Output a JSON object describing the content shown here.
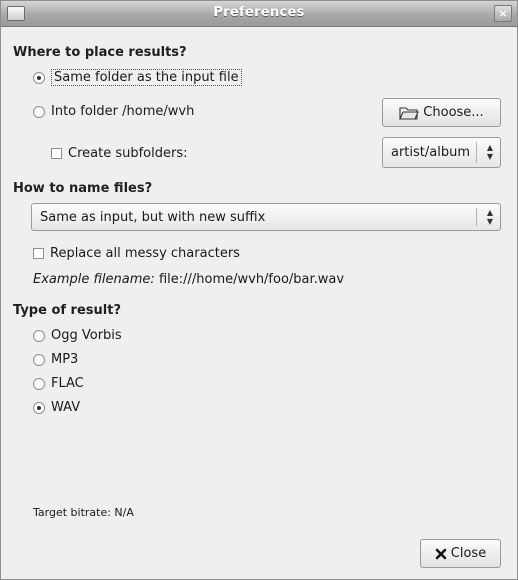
{
  "window": {
    "title": "Preferences",
    "close_glyph": "×"
  },
  "placement": {
    "heading": "Where to place results?",
    "same_folder_label": "Same folder as the input file",
    "into_folder_label": "Into folder /home/wvh",
    "choose_label": "Choose...",
    "subfolders_label": "Create subfolders:",
    "subfolder_pattern": "artist/album",
    "selected": "same_folder"
  },
  "naming": {
    "heading": "How to name files?",
    "scheme": "Same as input, but with new suffix",
    "replace_messy_label": "Replace all messy characters",
    "example_prefix": "Example filename:",
    "example_value": "file:///home/wvh/foo/bar.wav"
  },
  "result_type": {
    "heading": "Type of result?",
    "options": [
      "Ogg Vorbis",
      "MP3",
      "FLAC",
      "WAV"
    ],
    "selected": "WAV"
  },
  "bitrate": {
    "label": "Target bitrate: N/A"
  },
  "footer": {
    "close_label": "Close"
  },
  "icons": {
    "folder": "folder-icon",
    "close": "close-x-icon",
    "arrows": "up-down-arrows-icon"
  }
}
